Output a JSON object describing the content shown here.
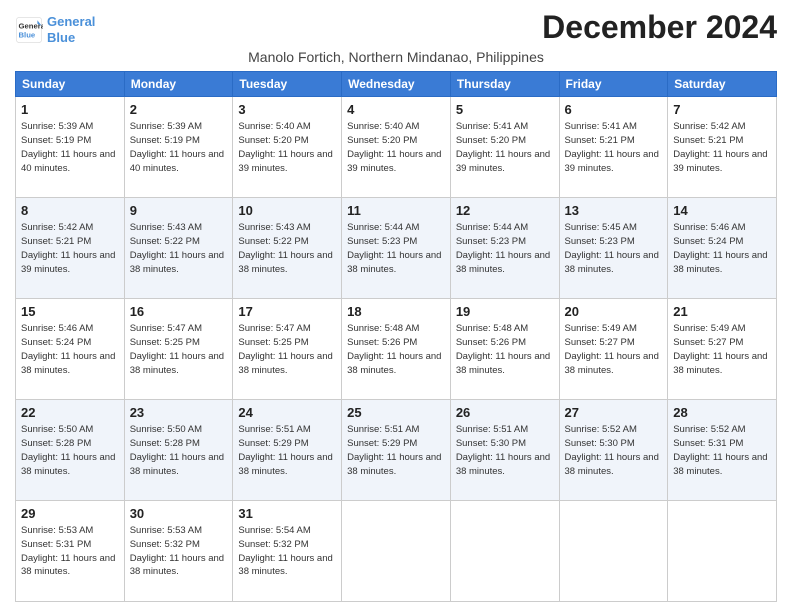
{
  "logo": {
    "line1": "General",
    "line2": "Blue"
  },
  "header": {
    "month_title": "December 2024",
    "subtitle": "Manolo Fortich, Northern Mindanao, Philippines"
  },
  "columns": [
    "Sunday",
    "Monday",
    "Tuesday",
    "Wednesday",
    "Thursday",
    "Friday",
    "Saturday"
  ],
  "weeks": [
    [
      {
        "day": "1",
        "sunrise": "5:39 AM",
        "sunset": "5:19 PM",
        "daylight": "11 hours and 40 minutes."
      },
      {
        "day": "2",
        "sunrise": "5:39 AM",
        "sunset": "5:19 PM",
        "daylight": "11 hours and 40 minutes."
      },
      {
        "day": "3",
        "sunrise": "5:40 AM",
        "sunset": "5:20 PM",
        "daylight": "11 hours and 39 minutes."
      },
      {
        "day": "4",
        "sunrise": "5:40 AM",
        "sunset": "5:20 PM",
        "daylight": "11 hours and 39 minutes."
      },
      {
        "day": "5",
        "sunrise": "5:41 AM",
        "sunset": "5:20 PM",
        "daylight": "11 hours and 39 minutes."
      },
      {
        "day": "6",
        "sunrise": "5:41 AM",
        "sunset": "5:21 PM",
        "daylight": "11 hours and 39 minutes."
      },
      {
        "day": "7",
        "sunrise": "5:42 AM",
        "sunset": "5:21 PM",
        "daylight": "11 hours and 39 minutes."
      }
    ],
    [
      {
        "day": "8",
        "sunrise": "5:42 AM",
        "sunset": "5:21 PM",
        "daylight": "11 hours and 39 minutes."
      },
      {
        "day": "9",
        "sunrise": "5:43 AM",
        "sunset": "5:22 PM",
        "daylight": "11 hours and 38 minutes."
      },
      {
        "day": "10",
        "sunrise": "5:43 AM",
        "sunset": "5:22 PM",
        "daylight": "11 hours and 38 minutes."
      },
      {
        "day": "11",
        "sunrise": "5:44 AM",
        "sunset": "5:23 PM",
        "daylight": "11 hours and 38 minutes."
      },
      {
        "day": "12",
        "sunrise": "5:44 AM",
        "sunset": "5:23 PM",
        "daylight": "11 hours and 38 minutes."
      },
      {
        "day": "13",
        "sunrise": "5:45 AM",
        "sunset": "5:23 PM",
        "daylight": "11 hours and 38 minutes."
      },
      {
        "day": "14",
        "sunrise": "5:46 AM",
        "sunset": "5:24 PM",
        "daylight": "11 hours and 38 minutes."
      }
    ],
    [
      {
        "day": "15",
        "sunrise": "5:46 AM",
        "sunset": "5:24 PM",
        "daylight": "11 hours and 38 minutes."
      },
      {
        "day": "16",
        "sunrise": "5:47 AM",
        "sunset": "5:25 PM",
        "daylight": "11 hours and 38 minutes."
      },
      {
        "day": "17",
        "sunrise": "5:47 AM",
        "sunset": "5:25 PM",
        "daylight": "11 hours and 38 minutes."
      },
      {
        "day": "18",
        "sunrise": "5:48 AM",
        "sunset": "5:26 PM",
        "daylight": "11 hours and 38 minutes."
      },
      {
        "day": "19",
        "sunrise": "5:48 AM",
        "sunset": "5:26 PM",
        "daylight": "11 hours and 38 minutes."
      },
      {
        "day": "20",
        "sunrise": "5:49 AM",
        "sunset": "5:27 PM",
        "daylight": "11 hours and 38 minutes."
      },
      {
        "day": "21",
        "sunrise": "5:49 AM",
        "sunset": "5:27 PM",
        "daylight": "11 hours and 38 minutes."
      }
    ],
    [
      {
        "day": "22",
        "sunrise": "5:50 AM",
        "sunset": "5:28 PM",
        "daylight": "11 hours and 38 minutes."
      },
      {
        "day": "23",
        "sunrise": "5:50 AM",
        "sunset": "5:28 PM",
        "daylight": "11 hours and 38 minutes."
      },
      {
        "day": "24",
        "sunrise": "5:51 AM",
        "sunset": "5:29 PM",
        "daylight": "11 hours and 38 minutes."
      },
      {
        "day": "25",
        "sunrise": "5:51 AM",
        "sunset": "5:29 PM",
        "daylight": "11 hours and 38 minutes."
      },
      {
        "day": "26",
        "sunrise": "5:51 AM",
        "sunset": "5:30 PM",
        "daylight": "11 hours and 38 minutes."
      },
      {
        "day": "27",
        "sunrise": "5:52 AM",
        "sunset": "5:30 PM",
        "daylight": "11 hours and 38 minutes."
      },
      {
        "day": "28",
        "sunrise": "5:52 AM",
        "sunset": "5:31 PM",
        "daylight": "11 hours and 38 minutes."
      }
    ],
    [
      {
        "day": "29",
        "sunrise": "5:53 AM",
        "sunset": "5:31 PM",
        "daylight": "11 hours and 38 minutes."
      },
      {
        "day": "30",
        "sunrise": "5:53 AM",
        "sunset": "5:32 PM",
        "daylight": "11 hours and 38 minutes."
      },
      {
        "day": "31",
        "sunrise": "5:54 AM",
        "sunset": "5:32 PM",
        "daylight": "11 hours and 38 minutes."
      },
      null,
      null,
      null,
      null
    ]
  ]
}
